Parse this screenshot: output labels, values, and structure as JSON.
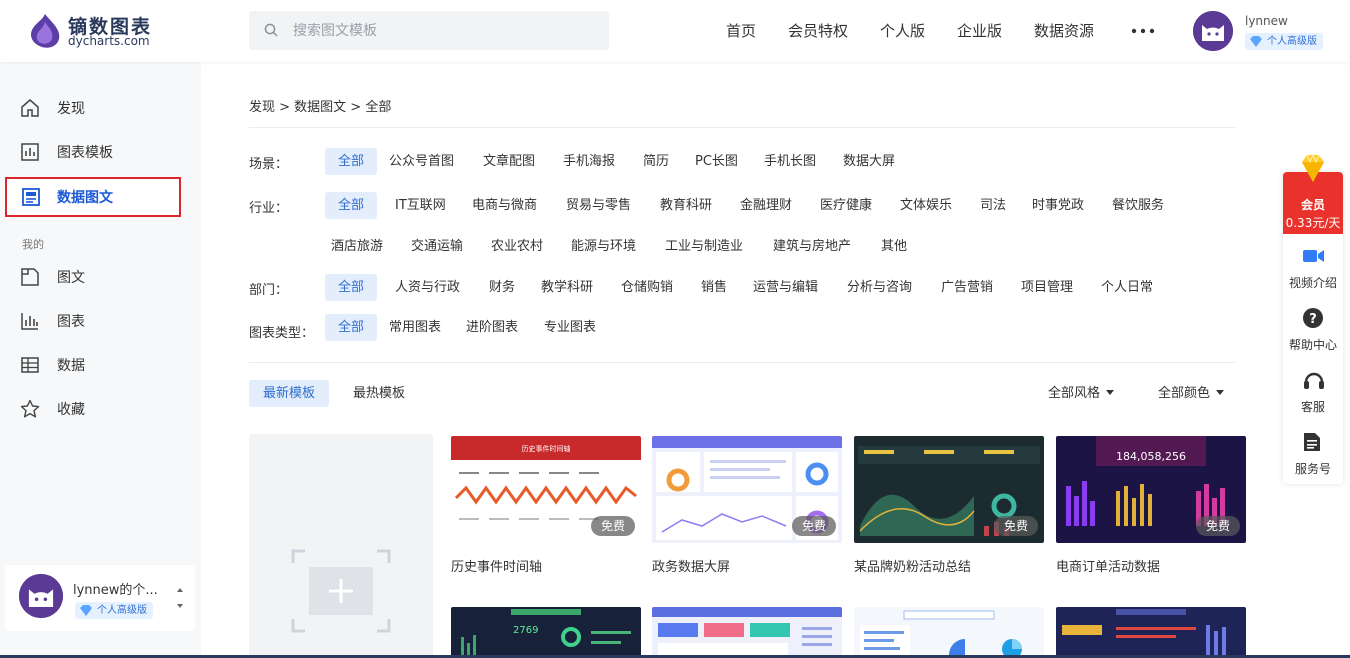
{
  "brand": {
    "name": "镝数图表",
    "domain": "dycharts.com"
  },
  "search": {
    "placeholder": "搜索图文模板"
  },
  "topnav": [
    "首页",
    "会员特权",
    "个人版",
    "企业版",
    "数据资源"
  ],
  "user": {
    "name": "lynnew",
    "badge": "个人高级版",
    "workspace": "lynnew的个..."
  },
  "sidebar": {
    "items": [
      {
        "label": "发现",
        "icon": "home-icon"
      },
      {
        "label": "图表模板",
        "icon": "bar-chart-icon"
      },
      {
        "label": "数据图文",
        "icon": "document-chart-icon"
      }
    ],
    "section": "我的",
    "my_items": [
      {
        "label": "图文",
        "icon": "doc-icon"
      },
      {
        "label": "图表",
        "icon": "chart-icon"
      },
      {
        "label": "数据",
        "icon": "table-icon"
      },
      {
        "label": "收藏",
        "icon": "star-icon"
      }
    ]
  },
  "breadcrumb": "发现 > 数据图文 > 全部",
  "filters": {
    "scene": {
      "label": "场景：",
      "options": [
        "全部",
        "公众号首图",
        "文章配图",
        "手机海报",
        "简历",
        "PC长图",
        "手机长图",
        "数据大屏"
      ]
    },
    "industry": {
      "label": "行业：",
      "options": [
        "全部",
        "IT互联网",
        "电商与微商",
        "贸易与零售",
        "教育科研",
        "金融理财",
        "医疗健康",
        "文体娱乐",
        "司法",
        "时事党政",
        "餐饮服务",
        "酒店旅游",
        "交通运输",
        "农业农村",
        "能源与环境",
        "工业与制造业",
        "建筑与房地产",
        "其他"
      ]
    },
    "dept": {
      "label": "部门：",
      "options": [
        "全部",
        "人资与行政",
        "财务",
        "教学科研",
        "仓储购销",
        "销售",
        "运营与编辑",
        "分析与咨询",
        "广告营销",
        "项目管理",
        "个人日常"
      ]
    },
    "charttype": {
      "label": "图表类型：",
      "options": [
        "全部",
        "常用图表",
        "进阶图表",
        "专业图表"
      ]
    }
  },
  "sort": {
    "tabs": [
      "最新模板",
      "最热模板"
    ],
    "style": "全部风格",
    "color": "全部颜色"
  },
  "cards": [
    {
      "name": "历史事件时间轴",
      "tag": "免费",
      "thumb_title": "历史事件时间轴"
    },
    {
      "name": "政务数据大屏",
      "tag": "免费"
    },
    {
      "name": "某品牌奶粉活动总结",
      "tag": "免费"
    },
    {
      "name": "电商订单活动数据",
      "tag": "免费",
      "big_number": "184,058,256"
    }
  ],
  "row2": {
    "big_number": "2769"
  },
  "float": {
    "vip_title": "会员",
    "vip_price": "0.33元/天",
    "items": [
      "视频介绍",
      "帮助中心",
      "客服",
      "服务号"
    ]
  },
  "colors": {
    "accent": "#2f6fd0",
    "highlight": "#e0242c",
    "vip": "#e8322b"
  }
}
